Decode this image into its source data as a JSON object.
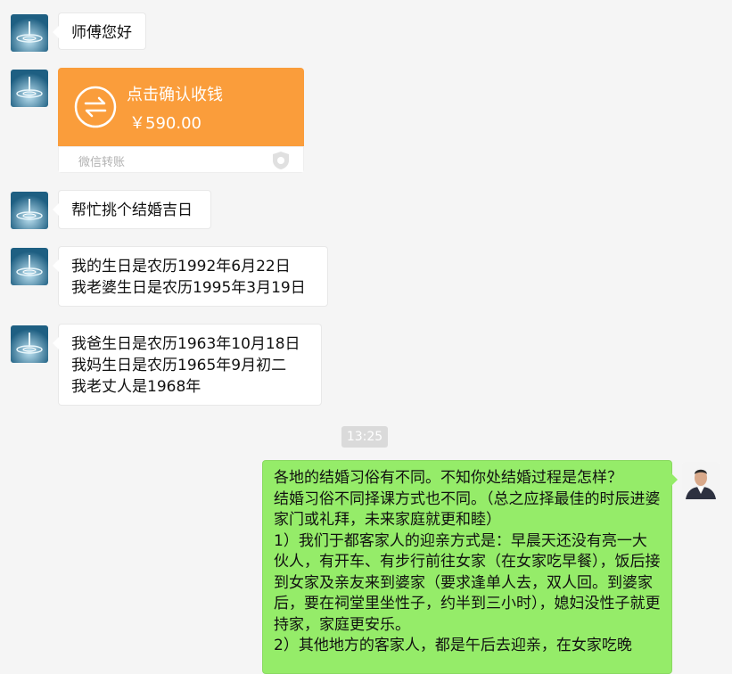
{
  "messages": {
    "m1": "师傅您好",
    "transfer": {
      "title": "点击确认收钱",
      "amount": "￥590.00",
      "label": "微信转账"
    },
    "m3": "帮忙挑个结婚吉日",
    "m4": "我的生日是农历1992年6月22日\n我老婆生日是农历1995年3月19日",
    "m5": "我爸生日是农历1963年10月18日\n我妈生日是农历1965年9月初二\n我老丈人是1968年",
    "timestamp": "13:25",
    "reply": "各地的结婚习俗有不同。不知你处结婚过程是怎样？\n结婚习俗不同择课方式也不同。（总之应择最佳的时辰进婆家门或礼拜，未来家庭就更和睦）\n1）我们于都客家人的迎亲方式是：早晨天还没有亮一大伙人，有开车、有步行前往女家（在女家吃早餐），饭后接到女家及亲友来到婆家（要求逢单人去，双人回。到婆家后，要在祠堂里坐性子，约半到三小时），媳妇没性子就更持家，家庭更安乐。\n2）其他地方的客家人，都是午后去迎亲，在女家吃晚"
  },
  "colors": {
    "background": "#f5f5f5",
    "transfer_orange": "#fa9d3b",
    "reply_green": "#95ec69"
  }
}
